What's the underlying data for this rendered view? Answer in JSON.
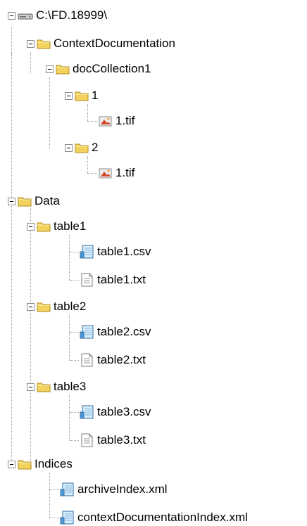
{
  "tree": {
    "root": {
      "label": "C:\\FD.18999\\",
      "icon": "drive-icon"
    },
    "context_documentation": {
      "label": "ContextDocumentation",
      "icon": "folder-icon",
      "doc_collection": {
        "label": "docCollection1",
        "folder_1": {
          "label": "1",
          "file": "1.tif"
        },
        "folder_2": {
          "label": "2",
          "file": "1.tif"
        }
      }
    },
    "data": {
      "label": "Data",
      "tables": [
        {
          "label": "table1",
          "csv": "table1.csv",
          "txt": "table1.txt"
        },
        {
          "label": "table2",
          "csv": "table2.csv",
          "txt": "table2.txt"
        },
        {
          "label": "table3",
          "csv": "table3.csv",
          "txt": "table3.txt"
        }
      ]
    },
    "indices": {
      "label": "Indices",
      "files": [
        "archiveIndex.xml",
        "contextDocumentationIndex.xml"
      ]
    }
  },
  "colors": {
    "folder": "#f3d35e",
    "folder_edge": "#b08a1c",
    "data_file": "#4f9ad6",
    "image_file": "#d24a2a"
  }
}
